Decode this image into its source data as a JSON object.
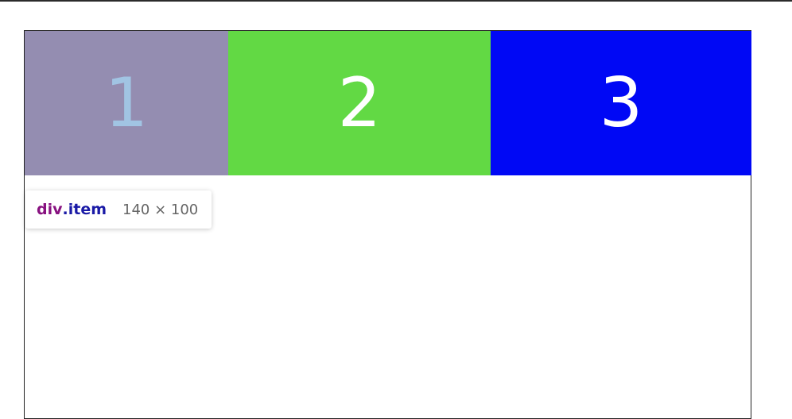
{
  "items": [
    {
      "label": "1",
      "color": "#a87f9a"
    },
    {
      "label": "2",
      "color": "#62d944"
    },
    {
      "label": "3",
      "color": "#0008f5"
    }
  ],
  "tooltip": {
    "tag": "div",
    "class": ".item",
    "size": "140 × 100"
  },
  "colors": {
    "highlight": "#6fa8dc",
    "tooltip_tag": "#881280",
    "tooltip_class": "#1a1aa6"
  }
}
